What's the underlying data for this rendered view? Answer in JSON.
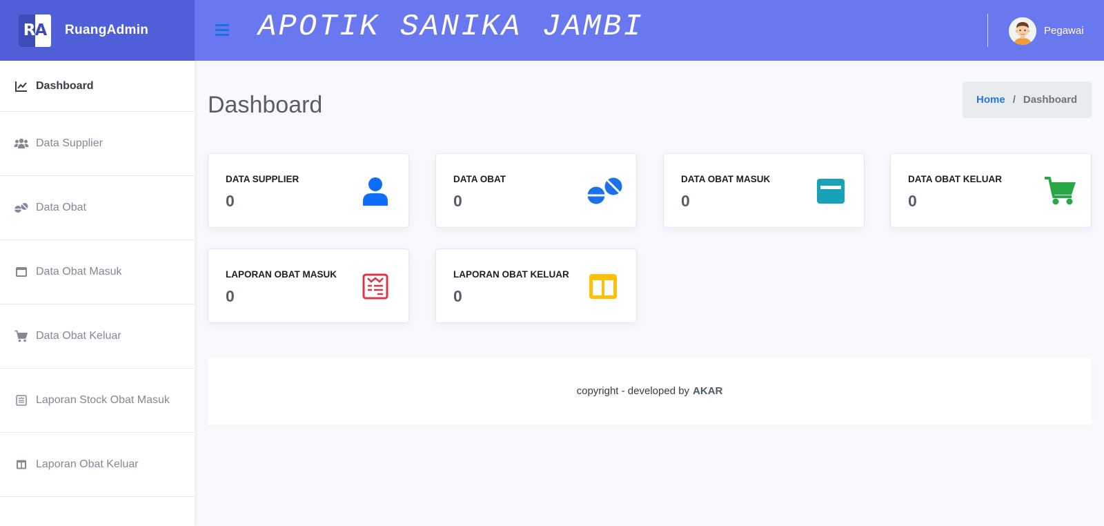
{
  "brand": {
    "logo_text_left": "R",
    "logo_text_right": "A",
    "name": "RuangAdmin"
  },
  "topbar": {
    "title": "APOTIK SANIKA JAMBI",
    "user_name": "Pegawai"
  },
  "sidebar": {
    "items": [
      {
        "label": "Dashboard",
        "icon": "chart-line-icon"
      },
      {
        "label": "Data Supplier",
        "icon": "users-icon"
      },
      {
        "label": "Data Obat",
        "icon": "pills-icon"
      },
      {
        "label": "Data Obat Masuk",
        "icon": "window-maximize-icon"
      },
      {
        "label": "Data Obat Keluar",
        "icon": "cart-icon"
      },
      {
        "label": "Laporan Stock Obat Masuk",
        "icon": "receipt-icon"
      },
      {
        "label": "Laporan Obat Keluar",
        "icon": "columns-icon"
      }
    ]
  },
  "page": {
    "title": "Dashboard"
  },
  "breadcrumb": {
    "home": "Home",
    "separator": "/",
    "current": "Dashboard"
  },
  "cards": [
    {
      "label": "DATA SUPPLIER",
      "value": "0",
      "icon": "user-icon",
      "color": "#0d6efd"
    },
    {
      "label": "DATA OBAT",
      "value": "0",
      "icon": "pills-icon",
      "color": "#1b72e8"
    },
    {
      "label": "DATA OBAT MASUK",
      "value": "0",
      "icon": "window-maximize-icon",
      "color": "#17a2b8"
    },
    {
      "label": "DATA OBAT KELUAR",
      "value": "0",
      "icon": "cart-icon",
      "color": "#28a745"
    },
    {
      "label": "LAPORAN OBAT MASUK",
      "value": "0",
      "icon": "receipt-icon",
      "color": "#dc3545"
    },
    {
      "label": "LAPORAN OBAT KELUAR",
      "value": "0",
      "icon": "columns-icon",
      "color": "#ffc107"
    }
  ],
  "footer": {
    "text": "copyright - developed by",
    "author": "AKAR"
  },
  "colors": {
    "topbar": "#6a78ef",
    "brand": "#4e5fd8",
    "link": "#2678e0"
  }
}
